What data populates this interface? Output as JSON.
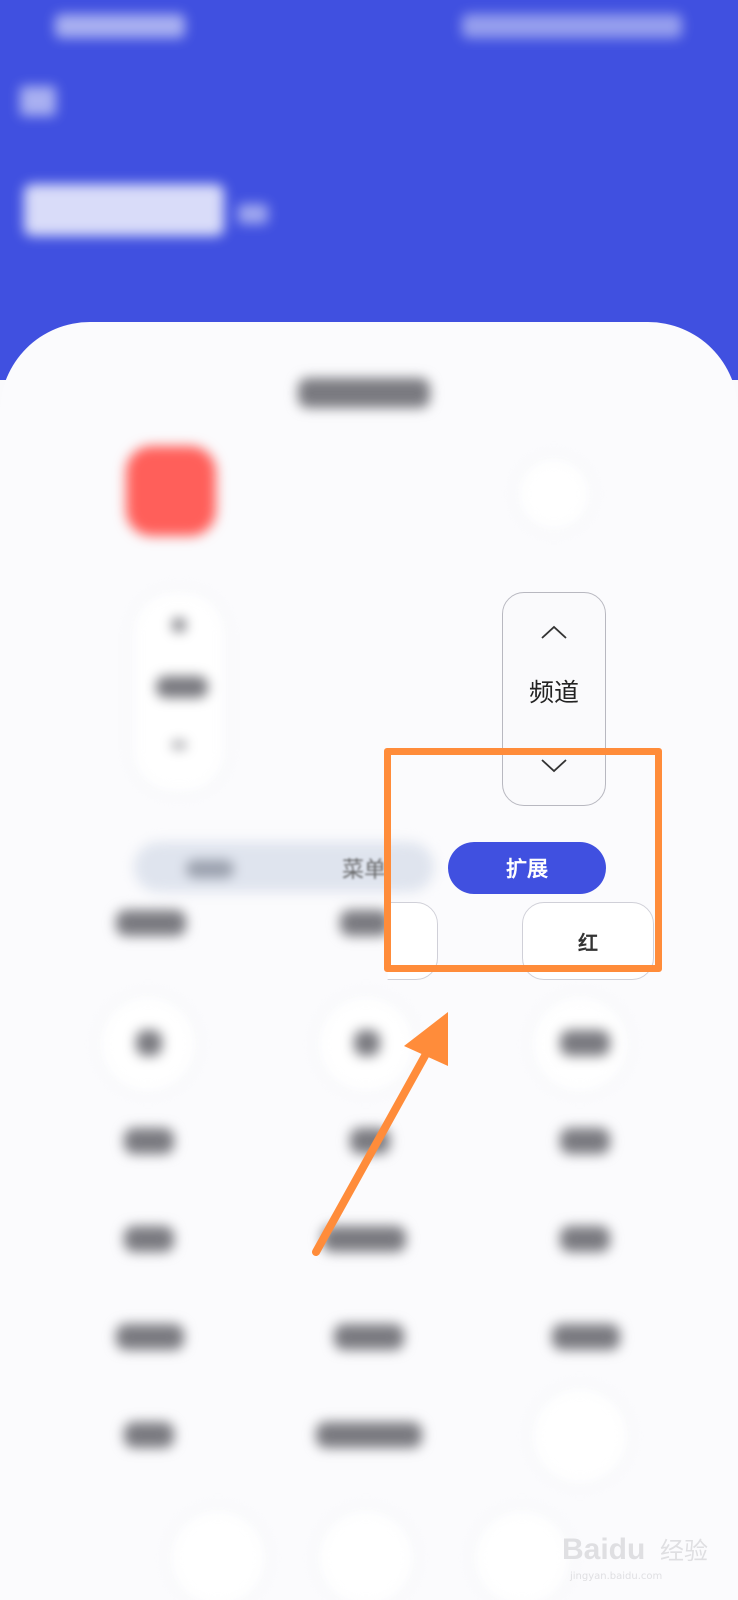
{
  "channel": {
    "label": "频道",
    "up_icon": "chevron-up-icon",
    "down_icon": "chevron-down-icon"
  },
  "tabs": {
    "menu": "菜单",
    "expand": "扩展"
  },
  "keys": {
    "red": "红"
  },
  "colors": {
    "header": "#4050e0",
    "accent": "#4050e0",
    "power": "#ff5f5a",
    "annotation": "#ff8c3a"
  },
  "watermark": {
    "brand": "Baidu",
    "suffix": "经验",
    "url": "jingyan.baidu.com"
  }
}
